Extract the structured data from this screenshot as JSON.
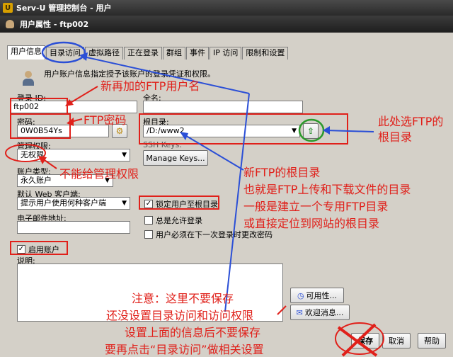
{
  "app": {
    "title": "Serv-U 管理控制台 - 用户",
    "logo_letter": "U"
  },
  "dialog": {
    "title": "用户属性 - ftp002"
  },
  "tabs": [
    {
      "label": "用户信息",
      "active": true
    },
    {
      "label": "目录访问"
    },
    {
      "label": "虚拟路径"
    },
    {
      "label": "正在登录"
    },
    {
      "label": "群组"
    },
    {
      "label": "事件"
    },
    {
      "label": "IP 访问"
    },
    {
      "label": "限制和设置"
    }
  ],
  "form": {
    "description": "用户账户信息指定授予该账户的登录凭证和权限。",
    "login_id_label": "登录 ID:",
    "login_id_value": "ftp002",
    "full_name_label": "全名:",
    "password_label": "密码:",
    "password_value": "0W0B54Ys",
    "root_dir_label": "根目录:",
    "root_dir_value": "/D:/www2",
    "admin_label": "管理权限:",
    "admin_value": "无权限",
    "ssh_label": "SSH Keys:",
    "manage_keys": "Manage Keys...",
    "account_type_label": "账户类型:",
    "account_type_value": "永久账户",
    "web_client_label": "默认 Web 客户端:",
    "web_client_value": "提示用户使用何种客户端",
    "email_label": "电子邮件地址:",
    "lock_root": "锁定用户至根目录",
    "always_allow": "总是允许登录",
    "must_change_pw": "用户必须在下一次登录时更改密码",
    "enable_account": "启用账户",
    "notes_label": "说明:",
    "availability_button": "可用性...",
    "welcome_button": "欢迎消息...",
    "save_button": "保存",
    "cancel_button": "取消",
    "help_button": "帮助"
  },
  "annotations": {
    "new_ftp_user": "新再加的FTP用户名",
    "ftp_password": "FTP密码",
    "no_admin": "不能给管理权限",
    "choose_root": [
      "此处选FTP的",
      "根目录"
    ],
    "root_explain": [
      "新FTP的根目录",
      "也就是FTP上传和下载文件的目录",
      "一般是建立一个专用FTP目录",
      "或直接定位到网站的根目录"
    ],
    "notice": [
      "注意：这里不要保存",
      "还没设置目录访问和访问权限",
      "设置上面的信息后不要保存",
      "要再点击“目录访问”做相关设置"
    ]
  },
  "colors": {
    "annotation_red": "#e0201a",
    "annotation_blue": "#2b4fd6"
  }
}
